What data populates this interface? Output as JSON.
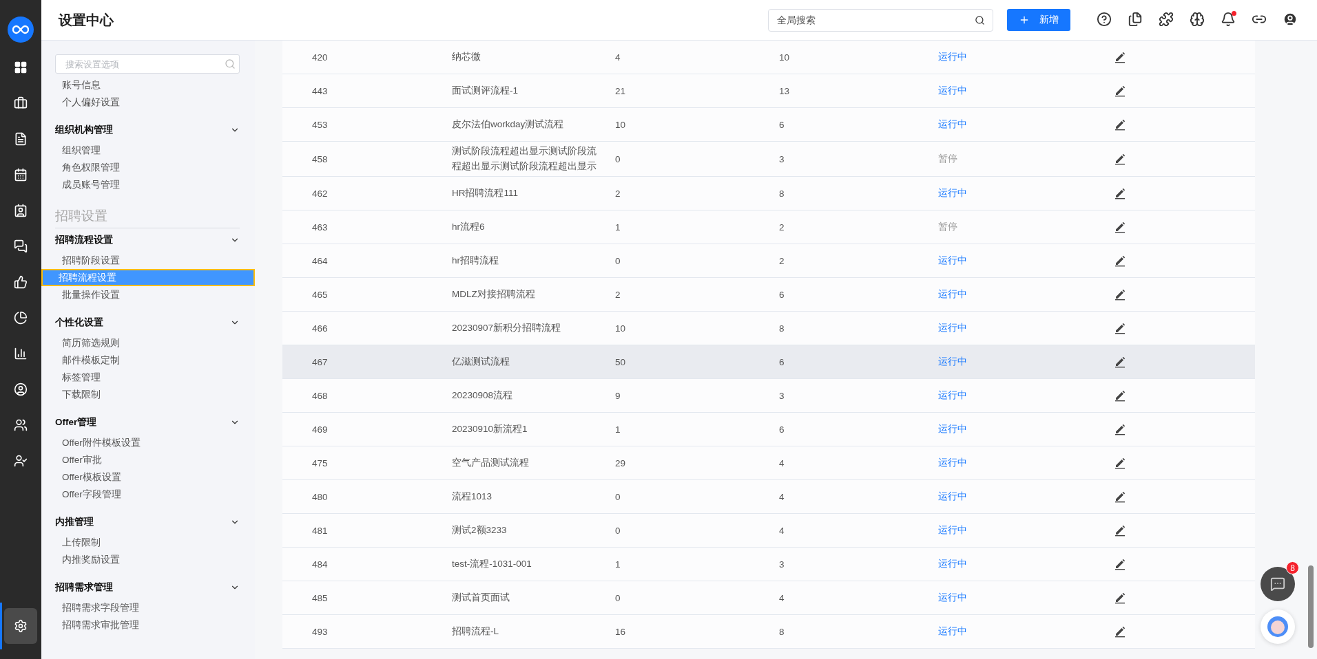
{
  "rail": [
    {
      "kind": "dashboard",
      "selected": false
    },
    {
      "kind": "briefcase",
      "selected": false
    },
    {
      "kind": "file",
      "selected": false
    },
    {
      "kind": "calendar",
      "selected": false
    },
    {
      "kind": "card",
      "selected": false
    },
    {
      "kind": "chat",
      "selected": false
    },
    {
      "kind": "thumb",
      "selected": false
    },
    {
      "kind": "pie",
      "selected": false
    },
    {
      "kind": "bars",
      "selected": false
    },
    {
      "kind": "person",
      "selected": false
    },
    {
      "kind": "people",
      "selected": false
    },
    {
      "kind": "talent",
      "selected": false
    },
    {
      "kind": "settings",
      "selected": true
    }
  ],
  "header": {
    "title": "设置中心",
    "search_placeholder": "全局搜索",
    "new_button": "新增",
    "icons": [
      {
        "kind": "help",
        "dot": false
      },
      {
        "kind": "docs",
        "dot": false
      },
      {
        "kind": "puzzle",
        "dot": false
      },
      {
        "kind": "brain",
        "dot": false
      },
      {
        "kind": "bell",
        "dot": true
      },
      {
        "kind": "link",
        "dot": false
      },
      {
        "kind": "user",
        "dot": false
      }
    ]
  },
  "sidebar": {
    "search_placeholder": "搜索设置选项",
    "entries": [
      {
        "kind": "link",
        "label": "账号信息",
        "selected": false
      },
      {
        "kind": "link",
        "label": "个人偏好设置",
        "selected": false
      },
      {
        "kind": "group",
        "label": "组织机构管理",
        "expanded": true,
        "children": [
          {
            "label": "组织管理",
            "selected": false
          },
          {
            "label": "角色权限管理",
            "selected": false
          },
          {
            "label": "成员账号管理",
            "selected": false
          }
        ]
      },
      {
        "kind": "section",
        "label": "招聘设置"
      },
      {
        "kind": "group",
        "label": "招聘流程设置",
        "expanded": true,
        "children": [
          {
            "label": "招聘阶段设置",
            "selected": false
          },
          {
            "label": "招聘流程设置",
            "selected": true
          },
          {
            "label": "批量操作设置",
            "selected": false
          }
        ]
      },
      {
        "kind": "group",
        "label": "个性化设置",
        "expanded": true,
        "children": [
          {
            "label": "简历筛选规则",
            "selected": false
          },
          {
            "label": "邮件模板定制",
            "selected": false
          },
          {
            "label": "标签管理",
            "selected": false
          },
          {
            "label": "下载限制",
            "selected": false
          }
        ]
      },
      {
        "kind": "group",
        "label": "Offer管理",
        "expanded": true,
        "children": [
          {
            "label": "Offer附件模板设置",
            "selected": false
          },
          {
            "label": "Offer审批",
            "selected": false
          },
          {
            "label": "Offer模板设置",
            "selected": false
          },
          {
            "label": "Offer字段管理",
            "selected": false
          }
        ]
      },
      {
        "kind": "group",
        "label": "内推管理",
        "expanded": true,
        "children": [
          {
            "label": "上传限制",
            "selected": false
          },
          {
            "label": "内推奖励设置",
            "selected": false
          }
        ]
      },
      {
        "kind": "group",
        "label": "招聘需求管理",
        "expanded": true,
        "children": [
          {
            "label": "招聘需求字段管理",
            "selected": false
          },
          {
            "label": "招聘需求审批管理",
            "selected": false
          }
        ]
      }
    ]
  },
  "table": {
    "rows": [
      {
        "id": "420",
        "name": "纳芯微",
        "column_3": "4",
        "column_4": "10",
        "status": "运行中",
        "running": true,
        "highlighted": false
      },
      {
        "id": "443",
        "name": "面试测评流程-1",
        "column_3": "21",
        "column_4": "13",
        "status": "运行中",
        "running": true,
        "highlighted": false
      },
      {
        "id": "453",
        "name": "皮尔法伯workday测试流程",
        "column_3": "10",
        "column_4": "6",
        "status": "运行中",
        "running": true,
        "highlighted": false
      },
      {
        "id": "458",
        "name": "测试阶段流程超出显示测试阶段流程超出显示测试阶段流程超出显示",
        "column_3": "0",
        "column_4": "3",
        "status": "暂停",
        "running": false,
        "highlighted": false
      },
      {
        "id": "462",
        "name": "HR招聘流程111",
        "column_3": "2",
        "column_4": "8",
        "status": "运行中",
        "running": true,
        "highlighted": false
      },
      {
        "id": "463",
        "name": "hr流程6",
        "column_3": "1",
        "column_4": "2",
        "status": "暂停",
        "running": false,
        "highlighted": false
      },
      {
        "id": "464",
        "name": "hr招聘流程",
        "column_3": "0",
        "column_4": "2",
        "status": "运行中",
        "running": true,
        "highlighted": false
      },
      {
        "id": "465",
        "name": "MDLZ对接招聘流程",
        "column_3": "2",
        "column_4": "6",
        "status": "运行中",
        "running": true,
        "highlighted": false
      },
      {
        "id": "466",
        "name": "20230907新积分招聘流程",
        "column_3": "10",
        "column_4": "8",
        "status": "运行中",
        "running": true,
        "highlighted": false
      },
      {
        "id": "467",
        "name": "亿滋测试流程",
        "column_3": "50",
        "column_4": "6",
        "status": "运行中",
        "running": true,
        "highlighted": true
      },
      {
        "id": "468",
        "name": "20230908流程",
        "column_3": "9",
        "column_4": "3",
        "status": "运行中",
        "running": true,
        "highlighted": false
      },
      {
        "id": "469",
        "name": "20230910新流程1",
        "column_3": "1",
        "column_4": "6",
        "status": "运行中",
        "running": true,
        "highlighted": false
      },
      {
        "id": "475",
        "name": "空气产品测试流程",
        "column_3": "29",
        "column_4": "4",
        "status": "运行中",
        "running": true,
        "highlighted": false
      },
      {
        "id": "480",
        "name": "流程1013",
        "column_3": "0",
        "column_4": "4",
        "status": "运行中",
        "running": true,
        "highlighted": false
      },
      {
        "id": "481",
        "name": "测试2额3233",
        "column_3": "0",
        "column_4": "4",
        "status": "运行中",
        "running": true,
        "highlighted": false
      },
      {
        "id": "484",
        "name": "test-流程-1031-001",
        "column_3": "1",
        "column_4": "3",
        "status": "运行中",
        "running": true,
        "highlighted": false
      },
      {
        "id": "485",
        "name": "测试首页面试",
        "column_3": "0",
        "column_4": "4",
        "status": "运行中",
        "running": true,
        "highlighted": false
      },
      {
        "id": "493",
        "name": "招聘流程-L",
        "column_3": "16",
        "column_4": "8",
        "status": "运行中",
        "running": true,
        "highlighted": false
      }
    ]
  },
  "chat_badge": "8"
}
